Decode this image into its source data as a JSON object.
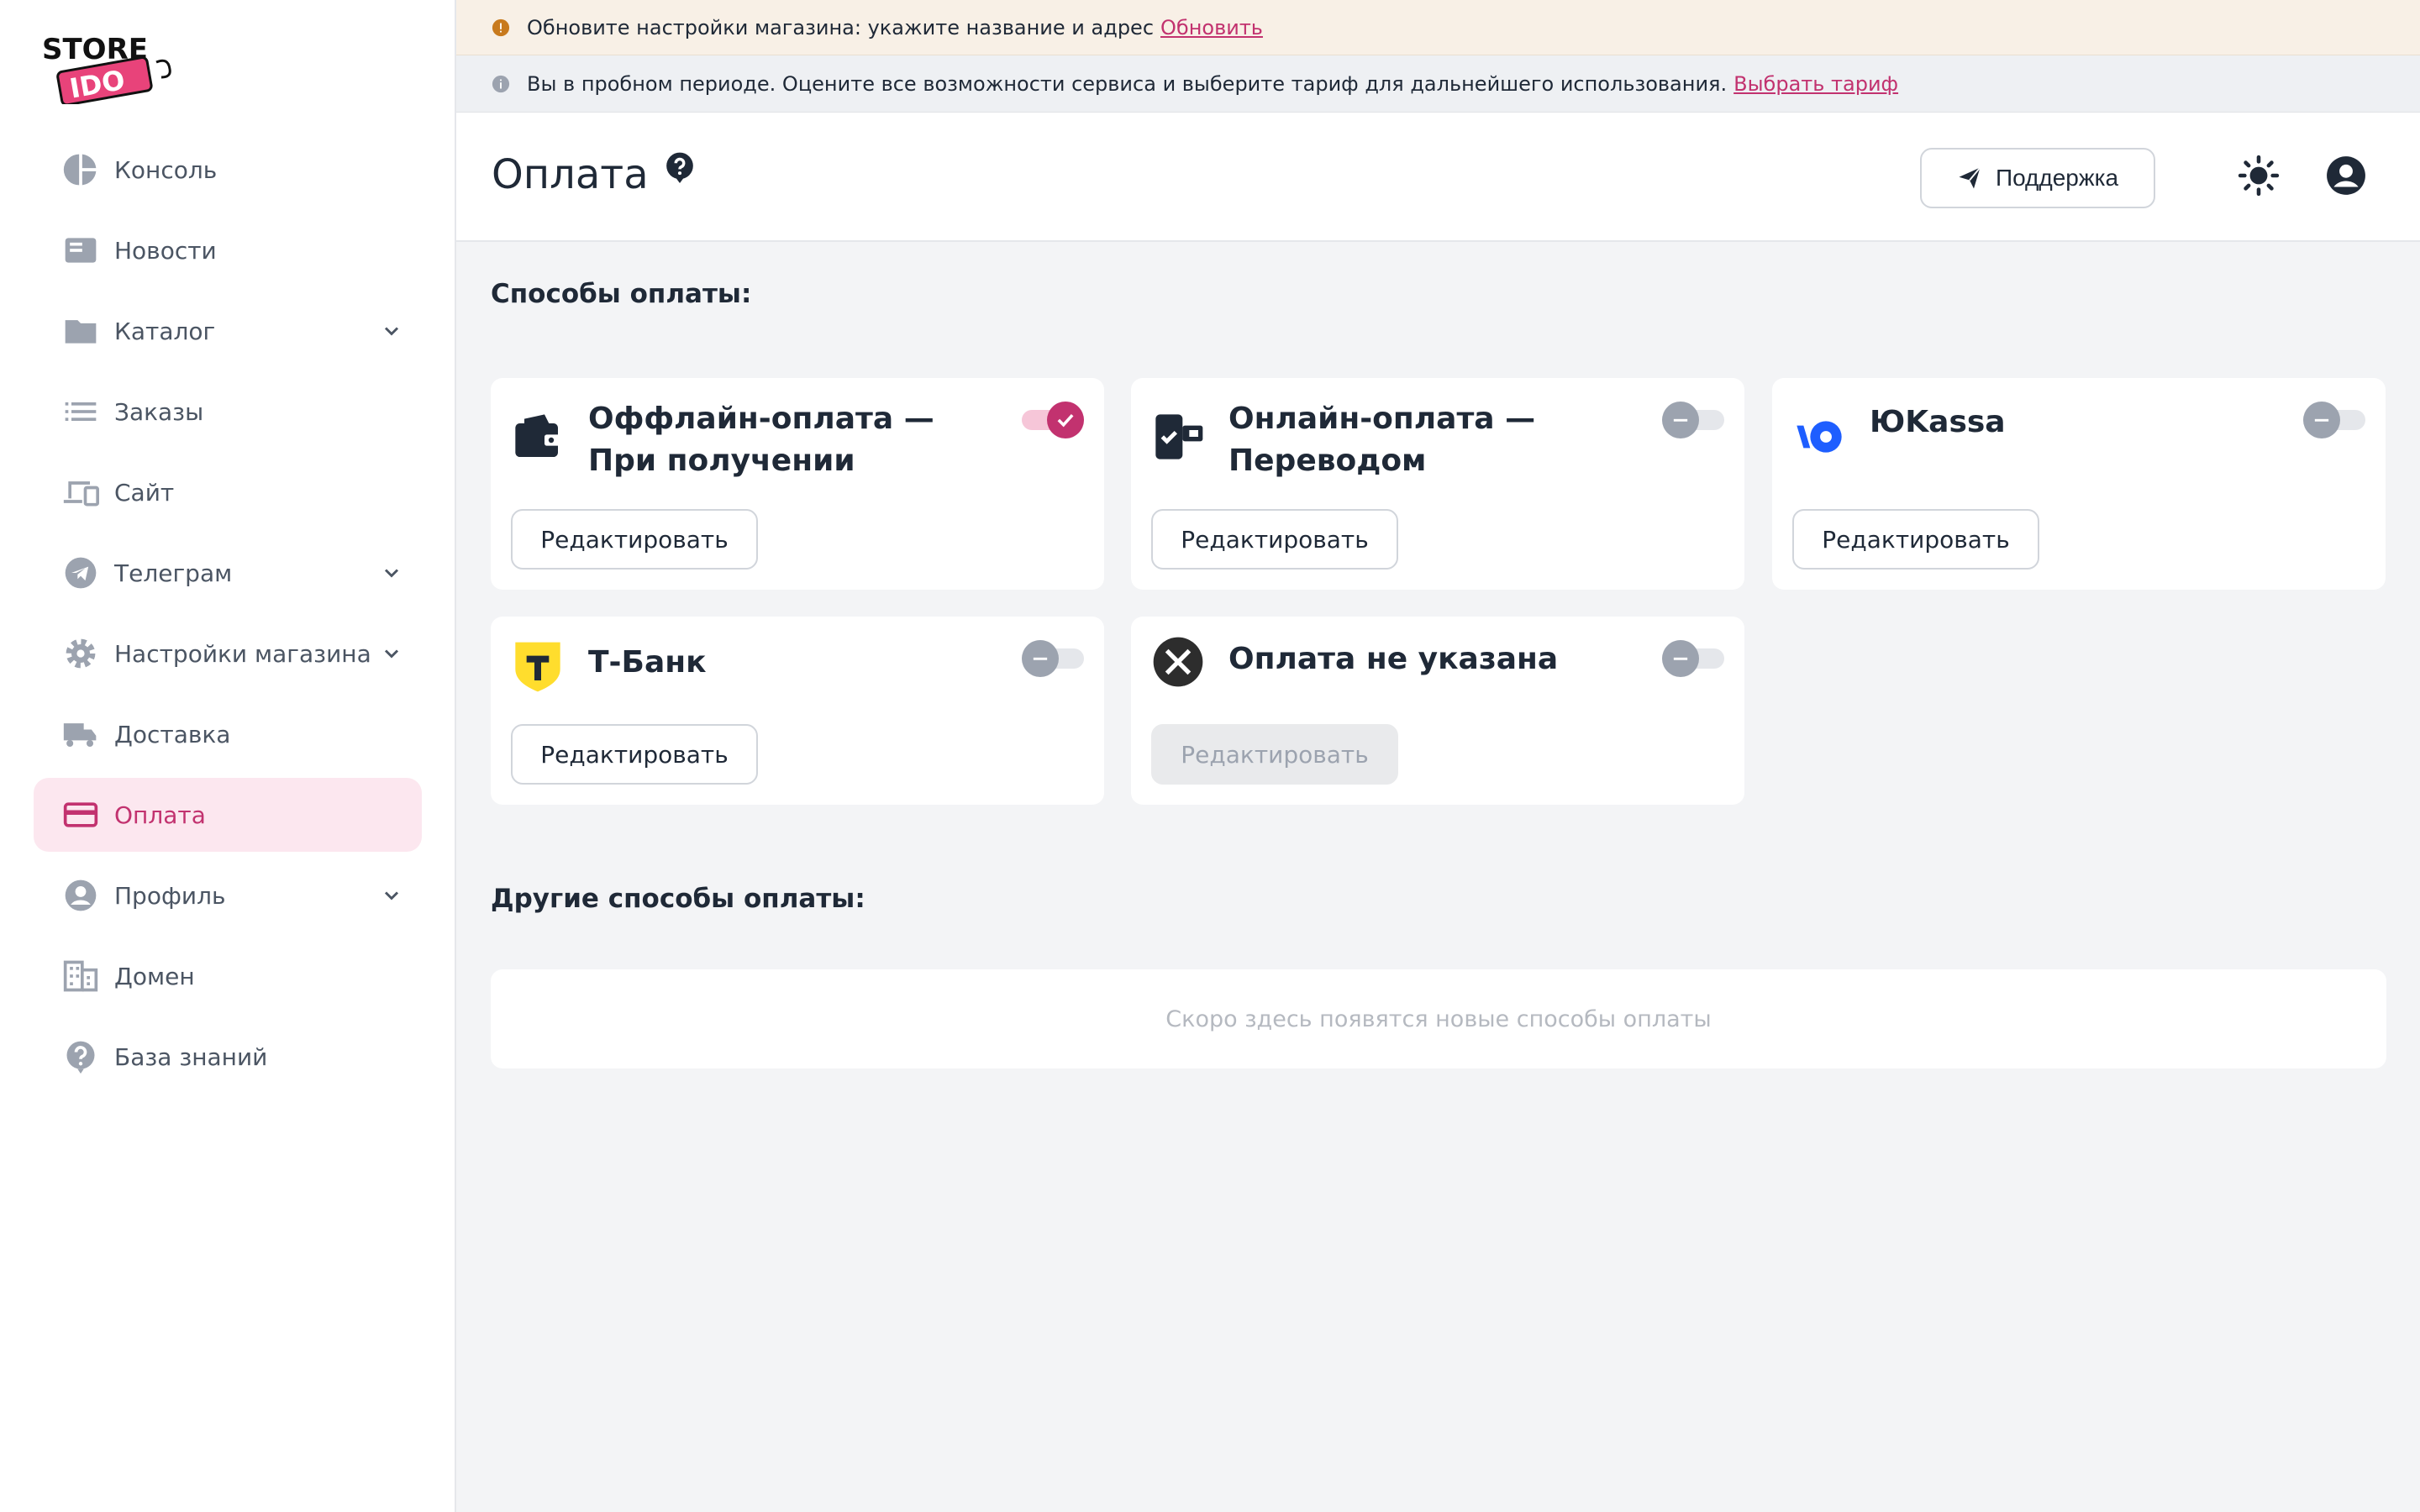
{
  "app": {
    "brand_top": "STORE",
    "brand_bottom": "IDO"
  },
  "sidebar": {
    "items": [
      {
        "label": "Консоль",
        "icon": "pie-chart-icon"
      },
      {
        "label": "Новости",
        "icon": "newspaper-icon"
      },
      {
        "label": "Каталог",
        "icon": "folder-icon",
        "expandable": true
      },
      {
        "label": "Заказы",
        "icon": "list-icon"
      },
      {
        "label": "Сайт",
        "icon": "devices-icon"
      },
      {
        "label": "Телеграм",
        "icon": "telegram-icon",
        "expandable": true
      },
      {
        "label": "Настройки магазина",
        "icon": "gear-icon",
        "expandable": true
      },
      {
        "label": "Доставка",
        "icon": "truck-icon"
      },
      {
        "label": "Оплата",
        "icon": "credit-card-icon",
        "active": true
      },
      {
        "label": "Профиль",
        "icon": "user-circle-icon",
        "expandable": true
      },
      {
        "label": "Домен",
        "icon": "building-icon"
      },
      {
        "label": "База знаний",
        "icon": "question-icon"
      }
    ]
  },
  "banners": {
    "settings": {
      "text": "Обновите настройки магазина: укажите название и адрес",
      "link": "Обновить"
    },
    "trial": {
      "text": "Вы в пробном периоде. Оцените все возможности сервиса и выберите тариф для дальнейшего использования.",
      "link": "Выбрать тариф"
    }
  },
  "header": {
    "title": "Оплата",
    "support_label": "Поддержка"
  },
  "payment_methods": {
    "title": "Способы оплаты:",
    "edit_label": "Редактировать",
    "cards": [
      {
        "title": "Оффлайн-оплата — При получении",
        "icon": "wallet-icon",
        "enabled": true
      },
      {
        "title": "Онлайн-оплата — Переводом",
        "icon": "phone-transfer-icon",
        "enabled": false
      },
      {
        "title": "ЮKassa",
        "icon": "yookassa-logo-icon",
        "enabled": false
      },
      {
        "title": "Т-Банк",
        "icon": "tbank-logo-icon",
        "enabled": false
      },
      {
        "title": "Оплата не указана",
        "icon": "cross-circle-icon",
        "enabled": false,
        "edit_disabled": true
      }
    ]
  },
  "other_methods": {
    "title": "Другие способы оплаты:",
    "empty_text": "Скоро здесь появятся новые способы оплаты"
  },
  "colors": {
    "accent": "#c2326f",
    "accent_light": "#fce7ef",
    "banner_warn_bg": "#f8f0e6",
    "banner_info_bg": "#eef0f3"
  }
}
